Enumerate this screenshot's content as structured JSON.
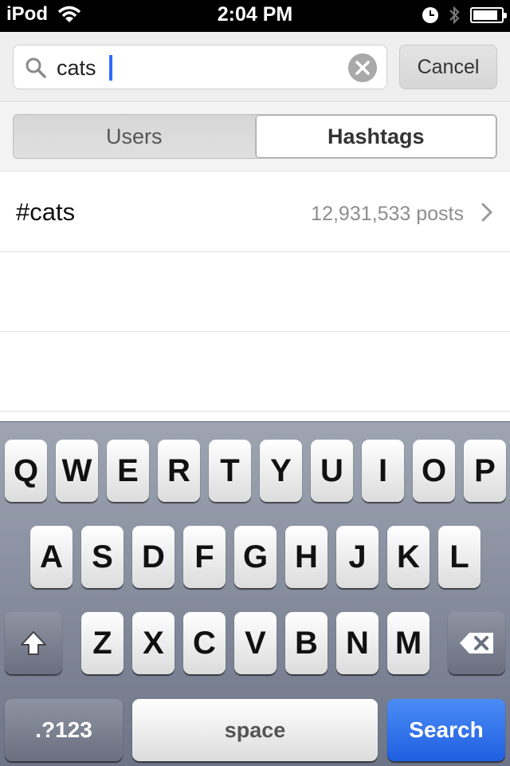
{
  "status_bar": {
    "carrier": "iPod",
    "time": "2:04 PM"
  },
  "search": {
    "value": "cats",
    "cancel_label": "Cancel"
  },
  "segments": {
    "users_label": "Users",
    "hashtags_label": "Hashtags",
    "selected": "Hashtags"
  },
  "results": [
    {
      "tag": "#cats",
      "count": "12,931,533 posts"
    }
  ],
  "keyboard": {
    "row1": [
      "Q",
      "W",
      "E",
      "R",
      "T",
      "Y",
      "U",
      "I",
      "O",
      "P"
    ],
    "row2": [
      "A",
      "S",
      "D",
      "F",
      "G",
      "H",
      "J",
      "K",
      "L"
    ],
    "row3": [
      "Z",
      "X",
      "C",
      "V",
      "B",
      "N",
      "M"
    ],
    "symbols_label": ".?123",
    "space_label": "space",
    "search_label": "Search",
    "shift_icon": "shift-icon",
    "delete_icon": "backspace-icon"
  },
  "colors": {
    "cursor": "#2f6bff",
    "search_key": "#1f5fe0"
  }
}
